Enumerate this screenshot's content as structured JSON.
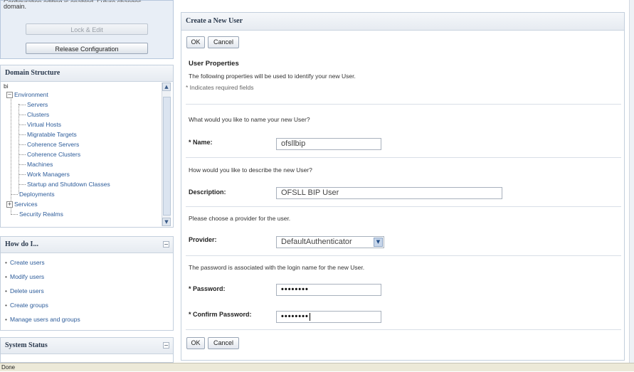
{
  "change_center": {
    "instruction_fragment": "domain.",
    "lock_edit_label": "Lock & Edit",
    "release_label": "Release Configuration"
  },
  "domain_structure": {
    "title": "Domain Structure",
    "root": "bi",
    "environment": "Environment",
    "environment_children": [
      "Servers",
      "Clusters",
      "Virtual Hosts",
      "Migratable Targets",
      "Coherence Servers",
      "Coherence Clusters",
      "Machines",
      "Work Managers",
      "Startup and Shutdown Classes"
    ],
    "deployments": "Deployments",
    "services": "Services",
    "security_realms": "Security Realms"
  },
  "how_do_i": {
    "title": "How do I...",
    "items": [
      "Create users",
      "Modify users",
      "Delete users",
      "Create groups",
      "Manage users and groups"
    ]
  },
  "system_status": {
    "title": "System Status"
  },
  "form": {
    "title": "Create a New User",
    "ok_label": "OK",
    "cancel_label": "Cancel",
    "section_title": "User Properties",
    "section_desc": "The following properties will be used to identify your new User.",
    "required_note": "* Indicates required fields",
    "name_question": "What would you like to name your new User?",
    "name_label": "* Name:",
    "name_value": "ofsllbip",
    "desc_question": "How would you like to describe the new User?",
    "desc_label": "Description:",
    "desc_value": "OFSLL BIP User",
    "provider_question": "Please choose a provider for the user.",
    "provider_label": "Provider:",
    "provider_value": "DefaultAuthenticator",
    "password_note": "The password is associated with the login name for the new User.",
    "password_label": "* Password:",
    "password_value": "••••••••",
    "confirm_label": "* Confirm Password:",
    "confirm_value": "••••••••"
  },
  "statusbar": {
    "text": "Done"
  },
  "icons": {
    "collapse": "minus-box-icon",
    "expand": "plus-box-icon",
    "scroll_up": "arrow-up-icon",
    "scroll_down": "arrow-down-icon",
    "select": "chevron-down-icon"
  }
}
